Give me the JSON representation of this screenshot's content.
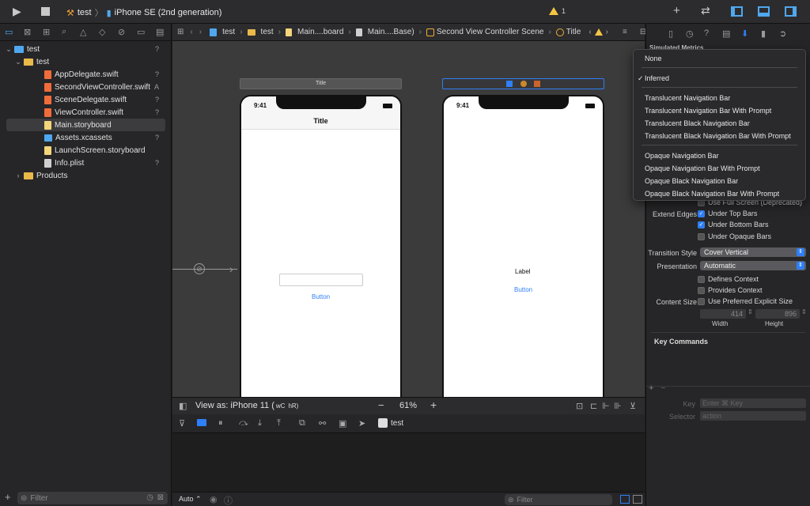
{
  "toolbar": {
    "project": "test",
    "device": "iPhone SE (2nd generation)",
    "warning_count": "1"
  },
  "navigator": {
    "items": [
      {
        "label": "test",
        "badge": "?"
      },
      {
        "label": "test",
        "badge": ""
      },
      {
        "label": "AppDelegate.swift",
        "badge": "?"
      },
      {
        "label": "SecondViewController.swift",
        "badge": "A"
      },
      {
        "label": "SceneDelegate.swift",
        "badge": "?"
      },
      {
        "label": "ViewController.swift",
        "badge": "?"
      },
      {
        "label": "Main.storyboard",
        "badge": ""
      },
      {
        "label": "Assets.xcassets",
        "badge": "?"
      },
      {
        "label": "LaunchScreen.storyboard",
        "badge": ""
      },
      {
        "label": "Info.plist",
        "badge": "?"
      },
      {
        "label": "Products",
        "badge": ""
      }
    ],
    "filter_placeholder": "Filter"
  },
  "jumpbar": {
    "crumbs": [
      "test",
      "test",
      "Main....board",
      "Main....Base)",
      "Second View Controller Scene",
      "Title"
    ]
  },
  "canvas": {
    "scene1": {
      "header": "Title",
      "time": "9:41",
      "nav_title": "Title",
      "button": "Button"
    },
    "scene2": {
      "time": "9:41",
      "label": "Label",
      "button": "Button"
    },
    "view_as": "View as: iPhone 11 (",
    "size_class_w": "wC",
    "size_class_h": "hR)",
    "zoom": "61%"
  },
  "debug": {
    "target": "test",
    "auto": "Auto",
    "filter_placeholder": "Filter"
  },
  "inspector": {
    "section_title": "Simulated Metrics",
    "partial_label": "Use Full Screen (Deprecated)",
    "extend_edges": "Extend Edges",
    "under_top": "Under Top Bars",
    "under_bottom": "Under Bottom Bars",
    "under_opaque": "Under Opaque Bars",
    "transition_style_label": "Transition Style",
    "transition_style": "Cover Vertical",
    "presentation_label": "Presentation",
    "presentation": "Automatic",
    "defines_context": "Defines Context",
    "provides_context": "Provides Context",
    "content_size_label": "Content Size",
    "use_preferred": "Use Preferred Explicit Size",
    "width_value": "414",
    "height_value": "896",
    "width_label": "Width",
    "height_label": "Height",
    "key_commands": "Key Commands",
    "key_label": "Key",
    "key_placeholder": "Enter ⌘ Key",
    "selector_label": "Selector",
    "selector_placeholder": "action"
  },
  "menu": {
    "items": [
      "None",
      "Inferred",
      "Translucent Navigation Bar",
      "Translucent Navigation Bar With Prompt",
      "Translucent Black Navigation Bar",
      "Translucent Black Navigation Bar With Prompt",
      "Opaque Navigation Bar",
      "Opaque Navigation Bar With Prompt",
      "Opaque Black Navigation Bar",
      "Opaque Black Navigation Bar With Prompt"
    ],
    "checkmark": "✓"
  },
  "colors": {
    "accent": "#2f7ff7",
    "warning": "#f5c542"
  }
}
